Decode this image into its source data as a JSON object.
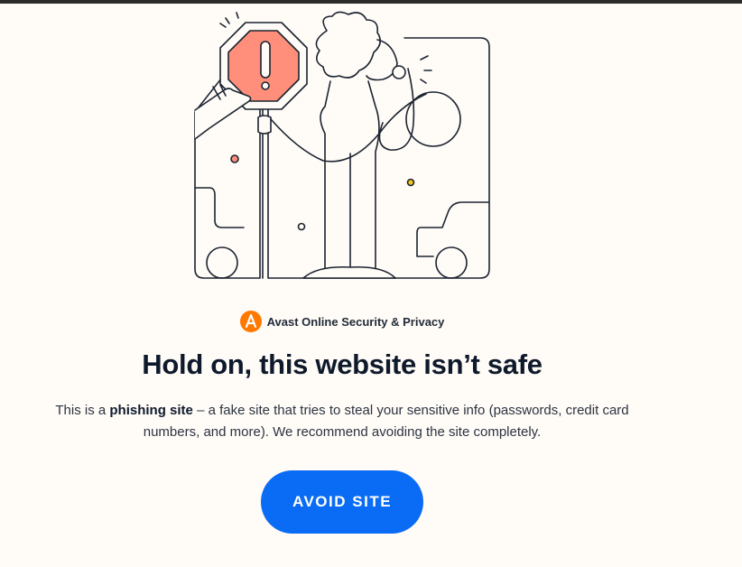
{
  "brand": {
    "name": "Avast Online Security & Privacy",
    "logo_icon": "avast-logo-icon",
    "logo_color": "#ff7800"
  },
  "warning": {
    "headline": "Hold on, this website isn’t safe",
    "message_prefix": "This is a ",
    "message_bold": "phishing site",
    "message_suffix": " – a fake site that tries to steal your sensitive info (passwords, credit card numbers, and more). We recommend avoiding the site completely."
  },
  "actions": {
    "avoid_label": "AVOID SITE",
    "avoid_color": "#0a6cf5"
  },
  "illustration": {
    "icon": "stop-sign-warning-illustration",
    "sign_color": "#ff8f7a",
    "accent_yellow": "#f5c518"
  }
}
